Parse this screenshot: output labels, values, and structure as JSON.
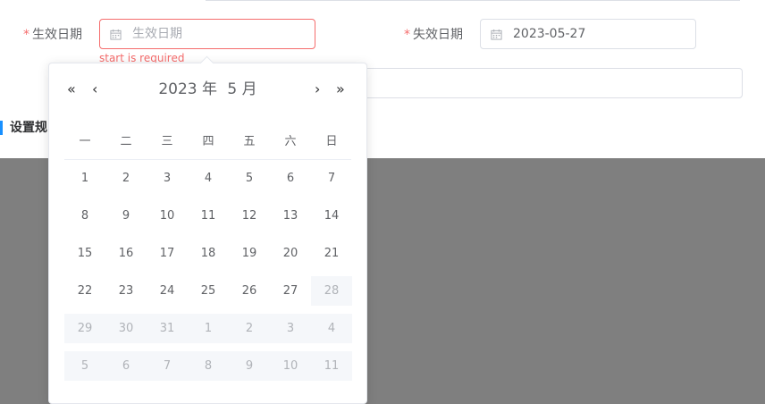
{
  "form": {
    "start_label": "生效日期",
    "start_placeholder": "生效日期",
    "start_error": "start is required",
    "end_label": "失效日期",
    "end_value": "2023-05-27",
    "section_title": "设置规",
    "required_mark": "*"
  },
  "datepicker": {
    "year_label": "2023 年",
    "month_label": "5 月",
    "prev_year": "«",
    "prev_month": "‹",
    "next_month": "›",
    "next_year": "»",
    "weekdays": [
      "一",
      "二",
      "三",
      "四",
      "五",
      "六",
      "日"
    ],
    "weeks": [
      [
        {
          "d": "1",
          "s": "cur"
        },
        {
          "d": "2",
          "s": "cur"
        },
        {
          "d": "3",
          "s": "cur"
        },
        {
          "d": "4",
          "s": "cur"
        },
        {
          "d": "5",
          "s": "cur"
        },
        {
          "d": "6",
          "s": "cur"
        },
        {
          "d": "7",
          "s": "cur"
        }
      ],
      [
        {
          "d": "8",
          "s": "cur"
        },
        {
          "d": "9",
          "s": "cur"
        },
        {
          "d": "10",
          "s": "cur"
        },
        {
          "d": "11",
          "s": "cur"
        },
        {
          "d": "12",
          "s": "cur"
        },
        {
          "d": "13",
          "s": "cur"
        },
        {
          "d": "14",
          "s": "cur"
        }
      ],
      [
        {
          "d": "15",
          "s": "cur"
        },
        {
          "d": "16",
          "s": "cur"
        },
        {
          "d": "17",
          "s": "cur"
        },
        {
          "d": "18",
          "s": "cur"
        },
        {
          "d": "19",
          "s": "cur"
        },
        {
          "d": "20",
          "s": "cur"
        },
        {
          "d": "21",
          "s": "cur"
        }
      ],
      [
        {
          "d": "22",
          "s": "cur"
        },
        {
          "d": "23",
          "s": "cur"
        },
        {
          "d": "24",
          "s": "cur"
        },
        {
          "d": "25",
          "s": "cur"
        },
        {
          "d": "26",
          "s": "cur"
        },
        {
          "d": "27",
          "s": "cur"
        },
        {
          "d": "28",
          "s": "dis"
        }
      ],
      [
        {
          "d": "29",
          "s": "dis"
        },
        {
          "d": "30",
          "s": "dis"
        },
        {
          "d": "31",
          "s": "dis"
        },
        {
          "d": "1",
          "s": "dis"
        },
        {
          "d": "2",
          "s": "dis"
        },
        {
          "d": "3",
          "s": "dis"
        },
        {
          "d": "4",
          "s": "dis"
        }
      ],
      [
        {
          "d": "5",
          "s": "dis"
        },
        {
          "d": "6",
          "s": "dis"
        },
        {
          "d": "7",
          "s": "dis"
        },
        {
          "d": "8",
          "s": "dis"
        },
        {
          "d": "9",
          "s": "dis"
        },
        {
          "d": "10",
          "s": "dis"
        },
        {
          "d": "11",
          "s": "dis"
        }
      ]
    ]
  },
  "colors": {
    "error": "#f56c6c",
    "accent": "#1890ff",
    "overlay": "#7f7f7f",
    "disabled_bg": "#f5f7fa"
  }
}
